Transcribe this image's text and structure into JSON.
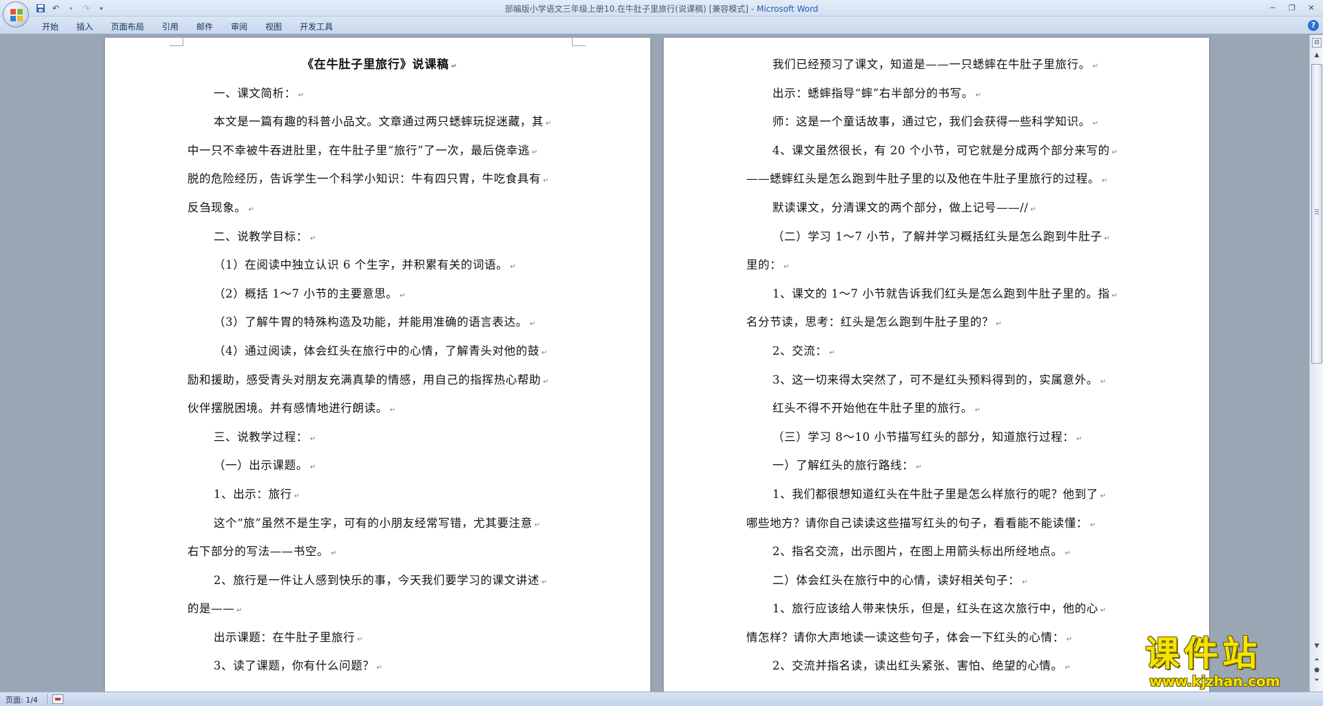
{
  "window": {
    "title": "部编版小学语文三年级上册10.在牛肚子里旅行(说课稿) [兼容模式] - ",
    "app_name": "Microsoft Word"
  },
  "quick_access": [
    "save-icon",
    "undo-icon",
    "redo-icon",
    "customize-icon"
  ],
  "ribbon": {
    "tabs": [
      "开始",
      "插入",
      "页面布局",
      "引用",
      "邮件",
      "审阅",
      "视图",
      "开发工具"
    ]
  },
  "document": {
    "left_page": {
      "title": "《在牛肚子里旅行》说课稿",
      "lines": [
        {
          "text": "一、课文简析：",
          "indent": true
        },
        {
          "text": "本文是一篇有趣的科普小品文。文章通过两只蟋蟀玩捉迷藏，其",
          "indent": true
        },
        {
          "text": "中一只不幸被牛吞进肚里，在牛肚子里“旅行”了一次，最后侥幸逃",
          "indent": false
        },
        {
          "text": "脱的危险经历，告诉学生一个科学小知识：牛有四只胃，牛吃食具有",
          "indent": false
        },
        {
          "text": "反刍现象。",
          "indent": false
        },
        {
          "text": "二、说教学目标：",
          "indent": true
        },
        {
          "text": "（1）在阅读中独立认识 6 个生字，并积累有关的词语。",
          "indent": true
        },
        {
          "text": "（2）概括 1～7 小节的主要意思。",
          "indent": true
        },
        {
          "text": "（3）了解牛胃的特殊构造及功能，并能用准确的语言表达。",
          "indent": true
        },
        {
          "text": "（4）通过阅读，体会红头在旅行中的心情，了解青头对他的鼓",
          "indent": true
        },
        {
          "text": "励和援助，感受青头对朋友充满真挚的情感，用自己的指挥热心帮助",
          "indent": false
        },
        {
          "text": "伙伴摆脱困境。并有感情地进行朗读。",
          "indent": false
        },
        {
          "text": "三、说教学过程：",
          "indent": true
        },
        {
          "text": "（一）出示课题。",
          "indent": true
        },
        {
          "text": "1、出示：旅行",
          "indent": true
        },
        {
          "text": "这个“旅”虽然不是生字，可有的小朋友经常写错，尤其要注意",
          "indent": true
        },
        {
          "text": "右下部分的写法——书空。",
          "indent": false
        },
        {
          "text": "2、旅行是一件让人感到快乐的事，今天我们要学习的课文讲述",
          "indent": true
        },
        {
          "text": "的是——",
          "indent": false
        },
        {
          "text": "出示课题：在牛肚子里旅行",
          "indent": true
        },
        {
          "text": "3、读了课题，你有什么问题？",
          "indent": true
        }
      ]
    },
    "right_page": {
      "lines": [
        {
          "text": "我们已经预习了课文，知道是——一只蟋蟀在牛肚子里旅行。",
          "indent": true
        },
        {
          "text": "出示：蟋蟀指导“蟀”右半部分的书写。",
          "indent": true
        },
        {
          "text": "师：这是一个童话故事，通过它，我们会获得一些科学知识。",
          "indent": true
        },
        {
          "text": "4、课文虽然很长，有 20 个小节，可它就是分成两个部分来写的",
          "indent": true
        },
        {
          "text": "——蟋蟀红头是怎么跑到牛肚子里的以及他在牛肚子里旅行的过程。",
          "indent": false
        },
        {
          "text": "默读课文，分清课文的两个部分，做上记号——//",
          "indent": true
        },
        {
          "text": "（二）学习 1～7 小节，了解并学习概括红头是怎么跑到牛肚子",
          "indent": true
        },
        {
          "text": "里的：",
          "indent": false
        },
        {
          "text": "1、课文的 1～7 小节就告诉我们红头是怎么跑到牛肚子里的。指",
          "indent": true
        },
        {
          "text": "名分节读，思考：红头是怎么跑到牛肚子里的？",
          "indent": false
        },
        {
          "text": "2、交流：",
          "indent": true
        },
        {
          "text": "3、这一切来得太突然了，可不是红头预料得到的，实属意外。",
          "indent": true
        },
        {
          "text": "红头不得不开始他在牛肚子里的旅行。",
          "indent": true
        },
        {
          "text": "（三）学习 8～10 小节描写红头的部分，知道旅行过程：",
          "indent": true
        },
        {
          "text": "一）了解红头的旅行路线：",
          "indent": true
        },
        {
          "text": "1、我们都很想知道红头在牛肚子里是怎么样旅行的呢？他到了",
          "indent": true
        },
        {
          "text": "哪些地方？请你自己读读这些描写红头的句子，看看能不能读懂：",
          "indent": false
        },
        {
          "text": "2、指名交流，出示图片，在图上用箭头标出所经地点。",
          "indent": true
        },
        {
          "text": "二）体会红头在旅行中的心情，读好相关句子：",
          "indent": true
        },
        {
          "text": "1、旅行应该给人带来快乐，但是，红头在这次旅行中，他的心",
          "indent": true
        },
        {
          "text": "情怎样？请你大声地读一读这些句子，体会一下红头的心情：",
          "indent": false
        },
        {
          "text": "2、交流并指名读，读出红头紧张、害怕、绝望的心情。",
          "indent": true
        }
      ]
    }
  },
  "paragraph_mark": "↵",
  "statusbar": {
    "page_label": "页面: 1/4"
  },
  "watermark": {
    "brand": "课件站",
    "url": "www.kjzhan.com"
  }
}
